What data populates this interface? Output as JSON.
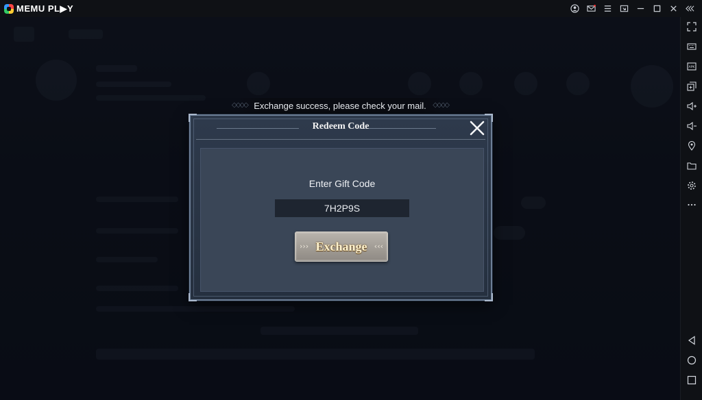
{
  "app": {
    "name": "MEMU PL▶Y"
  },
  "titlebar_icons": [
    "user-icon",
    "mail-icon",
    "menu-icon",
    "window-icon",
    "minimize-icon",
    "maximize-icon",
    "close-icon",
    "collapse-icon"
  ],
  "sidebar_top": [
    "fullscreen-icon",
    "keyboard-icon",
    "apk-icon",
    "multi-instance-icon",
    "volume-up-icon",
    "volume-down-icon",
    "location-icon",
    "folder-icon",
    "settings-icon",
    "more-icon"
  ],
  "sidebar_bottom": [
    "back-icon",
    "home-icon",
    "recents-icon"
  ],
  "toast": {
    "message": "Exchange success, please check your mail."
  },
  "dialog": {
    "title": "Redeem Code",
    "label": "Enter Gift Code",
    "code_value": "7H2P9S",
    "exchange_label": "Exchange"
  },
  "colors": {
    "accent_text": "#fff3cf",
    "panel": "#3a4657",
    "frame": "#6d7f97"
  }
}
